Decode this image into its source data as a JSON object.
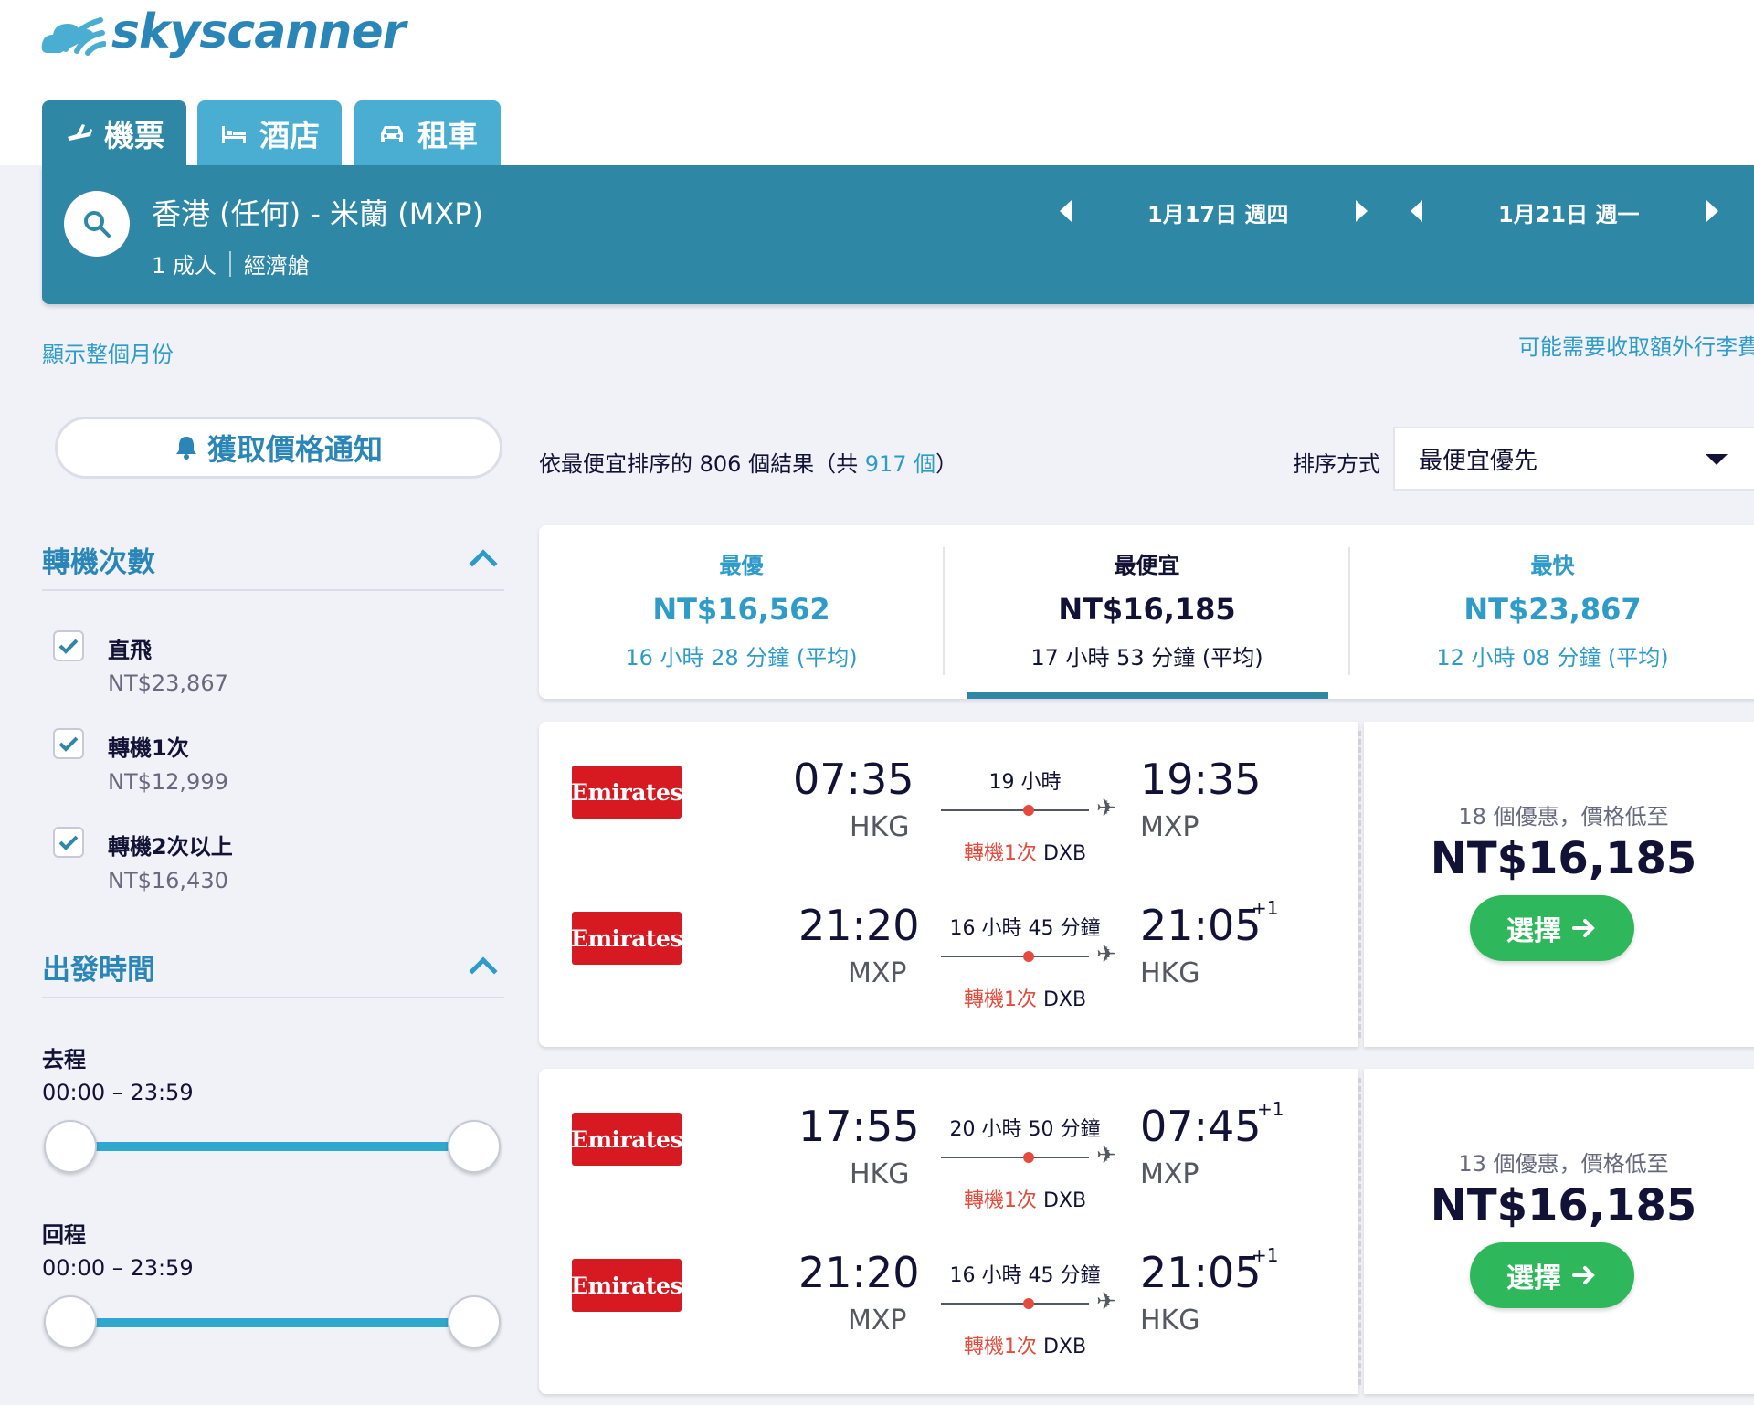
{
  "brand": {
    "name": "skyscanner"
  },
  "tabs": [
    {
      "label": "機票",
      "icon": "plane-icon",
      "active": true
    },
    {
      "label": "酒店",
      "icon": "bed-icon",
      "active": false
    },
    {
      "label": "租車",
      "icon": "car-icon",
      "active": false
    }
  ],
  "search": {
    "route": "香港 (任何) - 米蘭 (MXP)",
    "passengers": "1 成人",
    "cabin": "經濟艙",
    "depart_date": "1月17日 週四",
    "return_date": "1月21日 週一"
  },
  "links": {
    "show_month": "顯示整個月份",
    "baggage": "可能需要收取額外行李費"
  },
  "price_alert": {
    "label": "獲取價格通知"
  },
  "filters": {
    "stops": {
      "title": "轉機次數",
      "options": [
        {
          "label": "直飛",
          "price": "NT$23,867",
          "checked": true
        },
        {
          "label": "轉機1次",
          "price": "NT$12,999",
          "checked": true
        },
        {
          "label": "轉機2次以上",
          "price": "NT$16,430",
          "checked": true
        }
      ]
    },
    "times": {
      "title": "出發時間",
      "outbound_label": "去程",
      "outbound_range": "00:00 – 23:59",
      "return_label": "回程",
      "return_range": "00:00 – 23:59"
    }
  },
  "results": {
    "prefix": "依最便宜排序的 806 個結果（共 ",
    "total": "917 個",
    "suffix": "）"
  },
  "sort": {
    "label": "排序方式",
    "value": "最便宜優先"
  },
  "summary": [
    {
      "title": "最優",
      "price": "NT$16,562",
      "duration": "16 小時 28 分鐘 (平均)"
    },
    {
      "title": "最便宜",
      "price": "NT$16,185",
      "duration": "17 小時 53 分鐘 (平均)"
    },
    {
      "title": "最快",
      "price": "NT$23,867",
      "duration": "12 小時 08 分鐘 (平均)"
    }
  ],
  "itineraries": [
    {
      "legs": [
        {
          "airline": "Emirates",
          "dep_time": "07:35",
          "dep_ap": "HKG",
          "duration": "19 小時",
          "stops": "轉機1次",
          "via": "DXB",
          "arr_time": "19:35",
          "arr_ap": "MXP",
          "plus": ""
        },
        {
          "airline": "Emirates",
          "dep_time": "21:20",
          "dep_ap": "MXP",
          "duration": "16 小時 45 分鐘",
          "stops": "轉機1次",
          "via": "DXB",
          "arr_time": "21:05",
          "arr_ap": "HKG",
          "plus": "+1"
        }
      ],
      "deals": "18 個優惠，價格低至",
      "price": "NT$16,185",
      "button": "選擇"
    },
    {
      "legs": [
        {
          "airline": "Emirates",
          "dep_time": "17:55",
          "dep_ap": "HKG",
          "duration": "20 小時 50 分鐘",
          "stops": "轉機1次",
          "via": "DXB",
          "arr_time": "07:45",
          "arr_ap": "MXP",
          "plus": "+1"
        },
        {
          "airline": "Emirates",
          "dep_time": "21:20",
          "dep_ap": "MXP",
          "duration": "16 小時 45 分鐘",
          "stops": "轉機1次",
          "via": "DXB",
          "arr_time": "21:05",
          "arr_ap": "HKG",
          "plus": "+1"
        }
      ],
      "deals": "13 個優惠，價格低至",
      "price": "NT$16,185",
      "button": "選擇"
    }
  ],
  "colors": {
    "header": "#2f87a6",
    "tab_inactive": "#4aaed3",
    "link": "#2f9bc9",
    "select": "#2fb75c",
    "stop_red": "#e44b3c",
    "emirates": "#d71921"
  }
}
